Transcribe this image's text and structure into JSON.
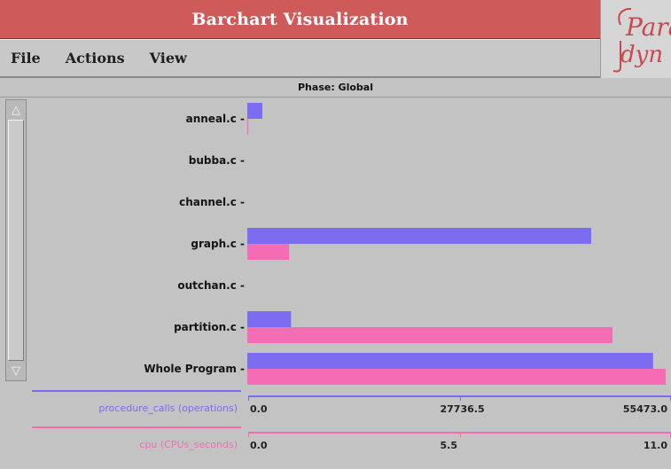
{
  "window": {
    "title": "Barchart Visualization"
  },
  "logo": {
    "text": "Paradyn"
  },
  "menu": {
    "items": [
      "File",
      "Actions",
      "View"
    ]
  },
  "phase_label": "Phase: Global",
  "colors": {
    "title_bar": "#cf5a5a",
    "series_procedure_calls": "#7b6cf2",
    "series_cpu": "#f46cb4",
    "background": "#c3c3c3"
  },
  "metrics": [
    {
      "name": "procedure_calls (operations)",
      "ticks": [
        "0.0",
        "27736.5",
        "55473.0"
      ]
    },
    {
      "name": "cpu (CPUs_seconds)",
      "ticks": [
        "0.0",
        "5.5",
        "11.0"
      ]
    }
  ],
  "chart_data": {
    "type": "bar",
    "orientation": "horizontal",
    "title": "Phase: Global",
    "categories": [
      "anneal.c",
      "bubba.c",
      "channel.c",
      "graph.c",
      "outchan.c",
      "partition.c",
      "Whole Program"
    ],
    "series": [
      {
        "name": "procedure_calls (operations)",
        "values": [
          2000,
          0,
          0,
          45600,
          0,
          5800,
          53800
        ],
        "xlim": [
          0,
          55473.0
        ]
      },
      {
        "name": "cpu (CPUs_seconds)",
        "values": [
          0.02,
          0,
          0,
          1.1,
          0,
          9.6,
          11.0
        ],
        "xlim": [
          0,
          11.0
        ]
      }
    ]
  }
}
